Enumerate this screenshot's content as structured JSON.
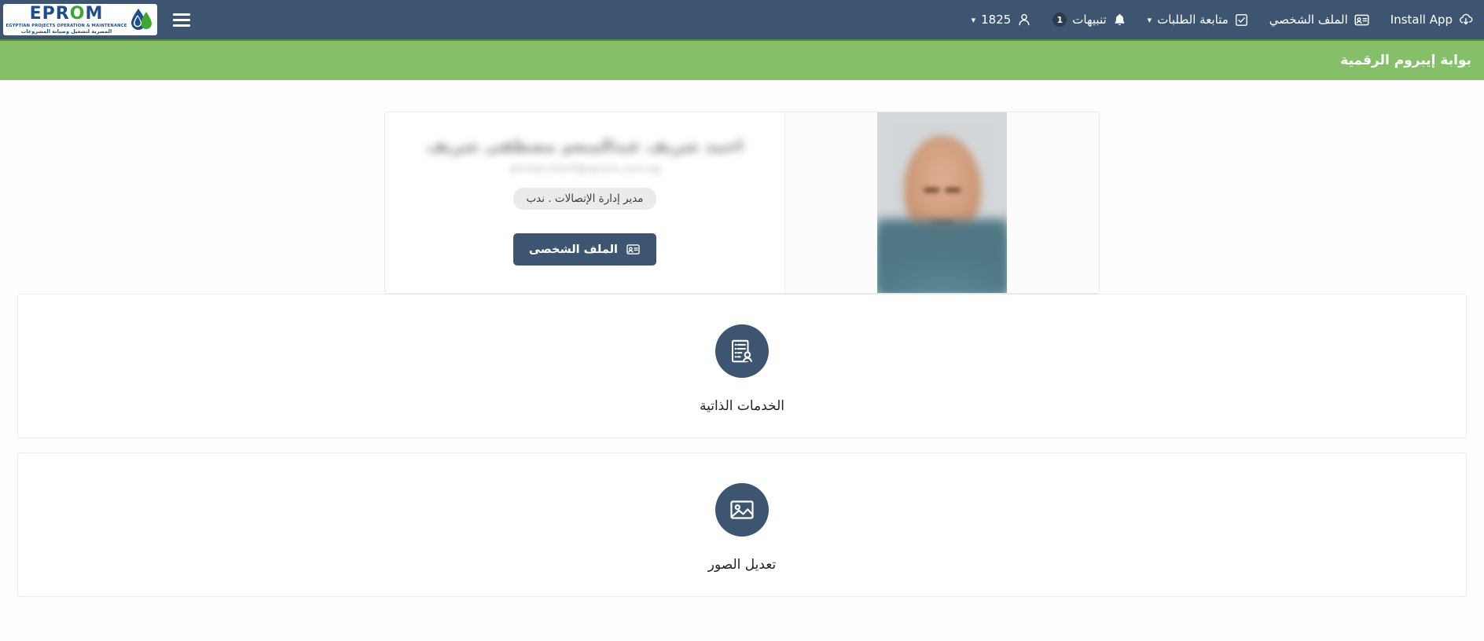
{
  "navbar": {
    "background_color": "#3d5570",
    "brand": {
      "name_part1": "EPR",
      "name_o": "O",
      "name_part2": "M",
      "subtitle_en": "EGYPTIAN PROJECTS OPERATION & MAINTENANCE",
      "subtitle_ar": "المصرية لتشغيل وصيانة المشروعات",
      "icon": "water-drop-icon"
    },
    "menu_icon": "hamburger-menu-icon",
    "items": [
      {
        "id": "install-app",
        "label": "Install App",
        "icon": "cloud-download-icon",
        "has_chevron": false,
        "badge": null
      },
      {
        "id": "profile",
        "label": "الملف الشخصي",
        "icon": "id-card-icon",
        "has_chevron": false,
        "badge": null
      },
      {
        "id": "track-requests",
        "label": "متابعة الطلبات",
        "icon": "checkbox-checked-icon",
        "has_chevron": true,
        "badge": null
      },
      {
        "id": "notifications",
        "label": "تنبيهات",
        "icon": "bell-icon",
        "has_chevron": false,
        "badge": "1"
      },
      {
        "id": "user-account",
        "label": "1825",
        "icon": "user-icon",
        "has_chevron": true,
        "badge": null
      }
    ]
  },
  "banner": {
    "title": "بوابة إيبروم الرقمية",
    "background_color": "#85bf69",
    "text_color": "#ffffff"
  },
  "profile_card": {
    "name_redacted": "احمد شريف عبدالمنعم مصطفى شريف",
    "email_redacted": "ahmed.sherif@eprom.com.eg",
    "role_badge": "مدير إدارة الإتصالات . ندب",
    "profile_button": {
      "label": "الملف الشخصى",
      "icon": "id-card-icon",
      "background_color": "#3d5570"
    },
    "photo": {
      "alt": "employee-portrait",
      "blurred": true
    }
  },
  "services": [
    {
      "id": "self-services",
      "label": "الخدمات الذاتية",
      "icon": "document-user-icon",
      "icon_bg": "#3d5570"
    },
    {
      "id": "edit-photos",
      "label": "تعديل الصور",
      "icon": "image-icon",
      "icon_bg": "#3d5570"
    }
  ]
}
